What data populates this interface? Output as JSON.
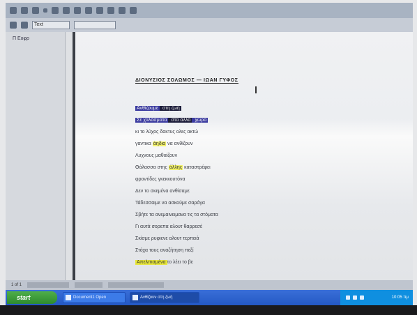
{
  "toolbar": {
    "style_value": "Text"
  },
  "navigator": {
    "title": "",
    "items": [
      "Π Ευφρ"
    ]
  },
  "document": {
    "title": "ΔΙΟΝΥΣΙΟΣ ΣΟΛΩΜΟΣ — ΙΩΑΝ ΓΥΦΟΣ",
    "lines": [
      [
        {
          "t": "Ανθίζουμε",
          "h": "blue"
        },
        {
          "t": " στη ζωή",
          "h": "dark"
        }
      ],
      [
        {
          "t": "Σε χαλάσματα",
          "h": "blue"
        },
        {
          "t": " στα άλλα",
          "h": "dark"
        },
        {
          "t": " χώρα",
          "h": "blue"
        }
      ],
      [
        {
          "t": "κι το λύχος δακτυς ολες ακτώ",
          "h": ""
        }
      ],
      [
        {
          "t": "γαντικα ",
          "h": ""
        },
        {
          "t": "άηδια",
          "h": "yellow"
        },
        {
          "t": " να ανθίζουν",
          "h": ""
        }
      ],
      [
        {
          "t": "Λυχνους μαθαίζουν",
          "h": ""
        }
      ],
      [
        {
          "t": "Θάλασσα στης ",
          "h": ""
        },
        {
          "t": "άλλης",
          "h": "yellow"
        },
        {
          "t": " καταστρέφει",
          "h": ""
        }
      ],
      [
        {
          "t": "φροντίδες γκεκκουτόνα",
          "h": ""
        }
      ],
      [
        {
          "t": "Δεν το σκεμένα ανθίσαμε",
          "h": ""
        }
      ],
      [
        {
          "t": "Τάδεσσαιμε να ασκούμε σαράγα",
          "h": ""
        }
      ],
      [
        {
          "t": "Σβήτε τα ανεμαινειμανα τις τα στόματα",
          "h": ""
        }
      ],
      [
        {
          "t": "Γι αυτά σορεπα αλουτ θαρρεσέ",
          "h": ""
        }
      ],
      [
        {
          "t": "Σκίσμε ρυφιενε αλουτ τερπειά",
          "h": ""
        }
      ],
      [
        {
          "t": "Στόχα τους αναζήτηση πεξί",
          "h": ""
        }
      ],
      [
        {
          "t": "Απελπισμένα",
          "h": "yellow-strong"
        },
        {
          "t": "το λέει το βε",
          "h": ""
        }
      ]
    ]
  },
  "statusbar": {
    "page": "1 of 1"
  },
  "taskbar": {
    "start": "start",
    "tasks": [
      "Document1 Open",
      "Ανθίζουν στη ζωή"
    ],
    "clock": "10:05 πμ"
  }
}
